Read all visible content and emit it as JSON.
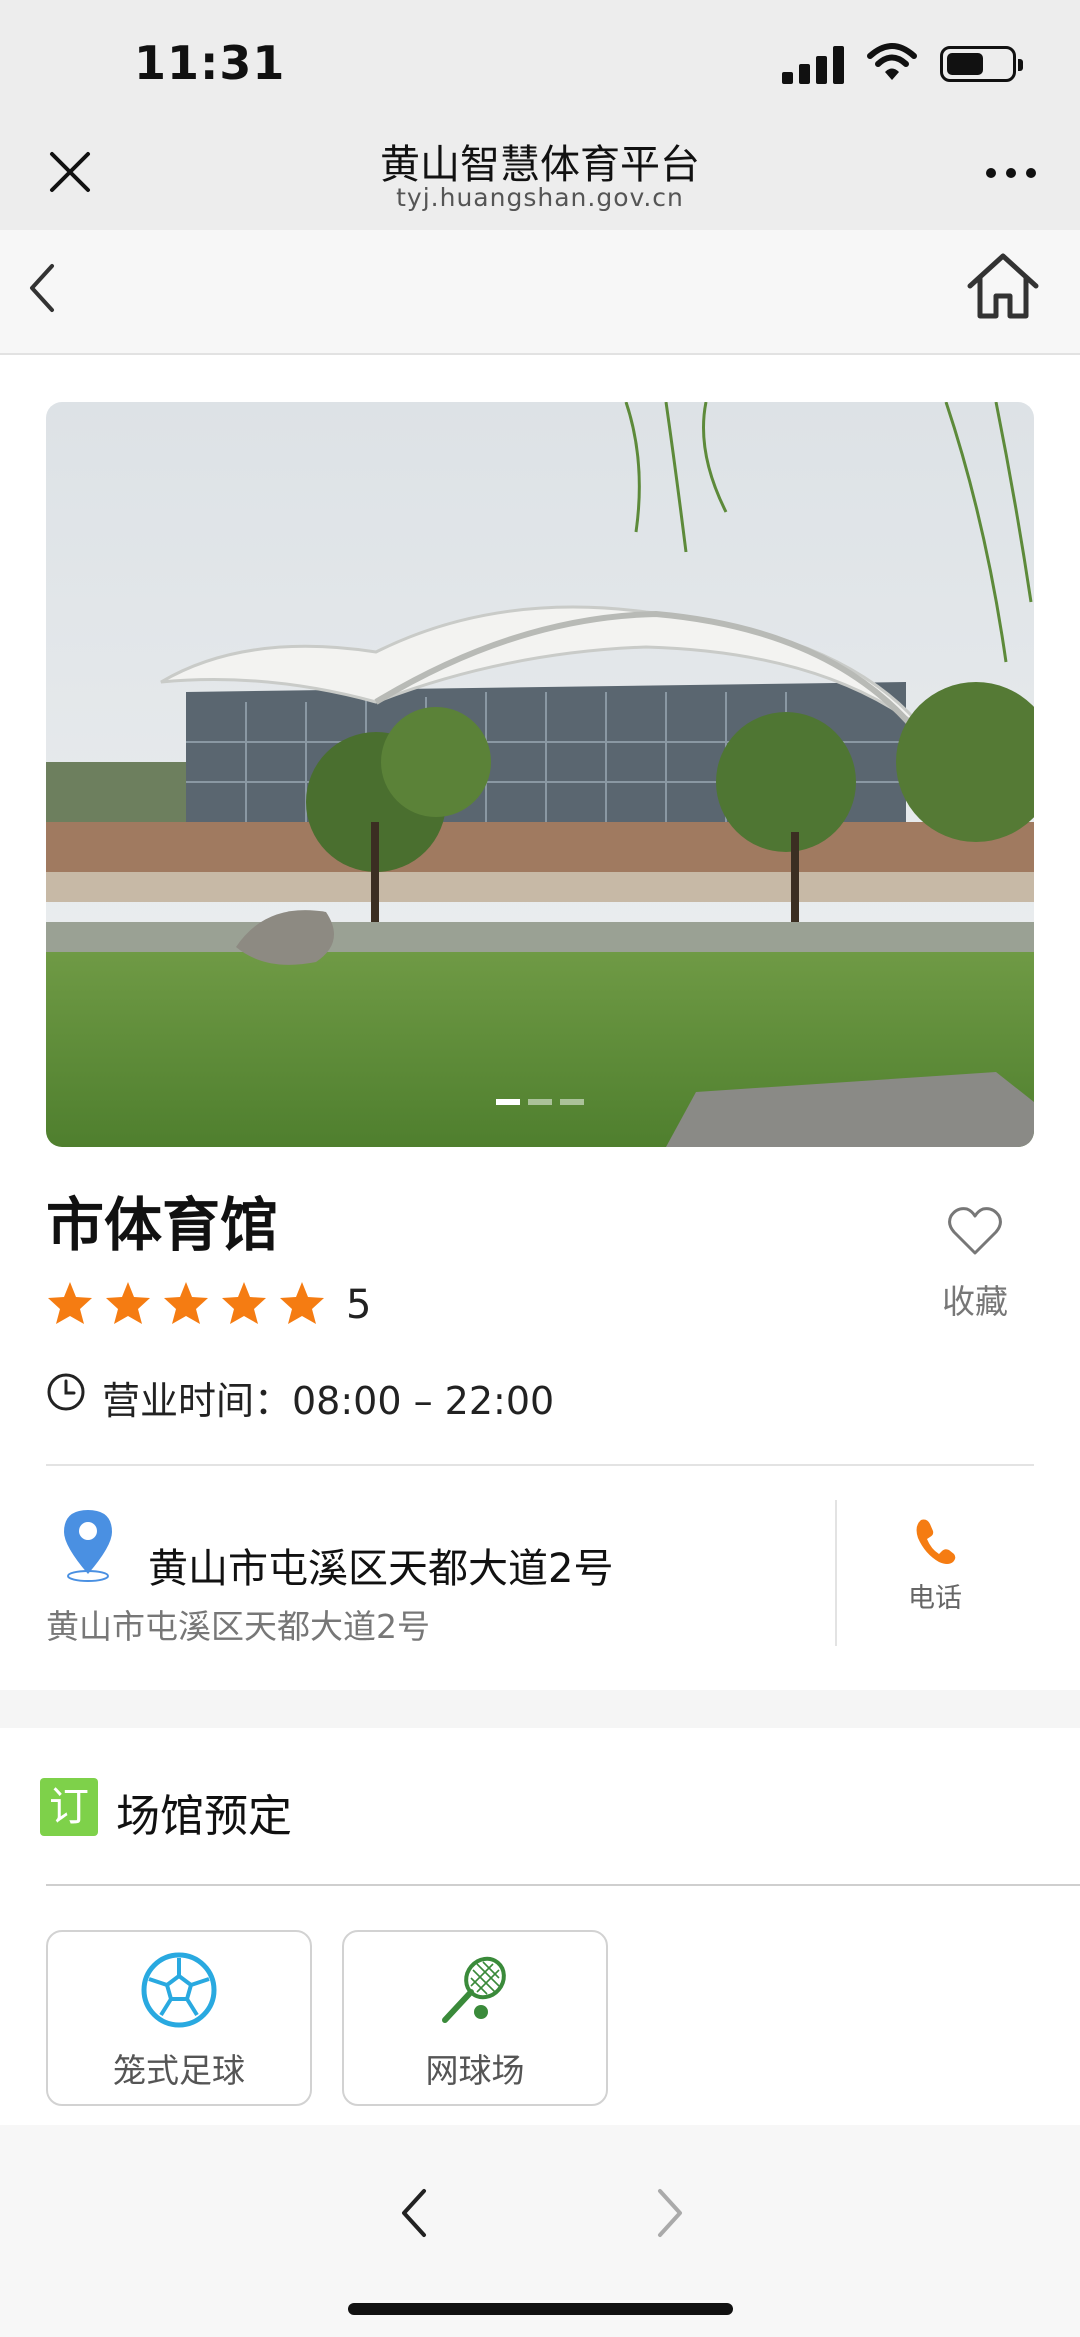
{
  "status_bar": {
    "time": "11:31"
  },
  "wechat_header": {
    "title": "黄山智慧体育平台",
    "url": "tyj.huangshan.gov.cn"
  },
  "banner": {
    "slide_count": 3,
    "active_index": 0
  },
  "venue": {
    "name": "市体育馆",
    "rating_value": "5",
    "stars": 5,
    "hours": "营业时间：08:00 – 22:00",
    "favorite_label": "收藏",
    "address_main": "黄山市屯溪区天都大道2号",
    "address_sub": "黄山市屯溪区天都大道2号",
    "phone_label": "电话"
  },
  "booking": {
    "badge": "订",
    "title": "场馆预定",
    "items": [
      {
        "label": "笼式足球",
        "icon": "soccer-ball-icon"
      },
      {
        "label": "网球场",
        "icon": "tennis-racket-icon"
      }
    ]
  },
  "colors": {
    "accent_orange": "#f57c12",
    "badge_green": "#7ed14a",
    "pin_blue": "#4a90e2",
    "soccer_blue": "#29a9e0",
    "tennis_green": "#3a8a3a"
  }
}
